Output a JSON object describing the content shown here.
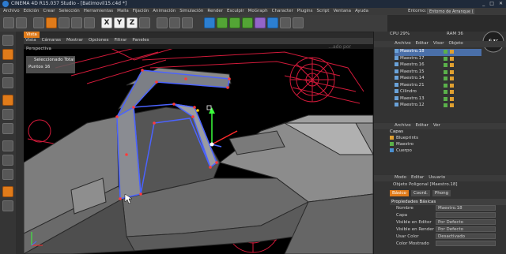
{
  "window": {
    "title": "CINEMA 4D R15.037 Studio - [Batimovil15.c4d *]",
    "controls": [
      "_",
      "□",
      "✕"
    ]
  },
  "menubar": {
    "items": [
      "Archivo",
      "Edición",
      "Crear",
      "Selección",
      "Herramientas",
      "Malla",
      "Fijación",
      "Animación",
      "Simulación",
      "Render",
      "Esculpir",
      "MoGraph",
      "Character",
      "Plugins",
      "Script",
      "Ventana",
      "Ayuda"
    ],
    "entorno_label": "Entorno:",
    "entorno_value": "Entorno de Arranque (Usuario)"
  },
  "toolbar": {
    "xyz": [
      "X",
      "Y",
      "Z"
    ]
  },
  "viewport": {
    "tab": "Vista",
    "menu": [
      "Vista",
      "Cámaras",
      "Mostrar",
      "Opciones",
      "Filtrar",
      "Paneles"
    ],
    "label": "Perspectiva",
    "selection_title": "Seleccionado Total",
    "points_label": "Puntos",
    "points_value": "16",
    "watermark": "...ado por"
  },
  "rightpanel": {
    "cpu": "CPU 29%",
    "ram": "RAM 36",
    "objects_menu": [
      "Archivo",
      "Editar",
      "Visor",
      "Objeto"
    ],
    "objects": [
      {
        "name": "Maestro.18",
        "selected": true
      },
      {
        "name": "Maestro.17",
        "selected": false
      },
      {
        "name": "Maestro.16",
        "selected": false
      },
      {
        "name": "Maestro.15",
        "selected": false
      },
      {
        "name": "Maestro.14",
        "selected": false
      },
      {
        "name": "Maestro.21",
        "selected": false
      },
      {
        "name": "Cilindro",
        "selected": false
      },
      {
        "name": "Maestro.13",
        "selected": false
      },
      {
        "name": "Maestro.12",
        "selected": false
      }
    ],
    "layers_menu": [
      "Archivo",
      "Editar",
      "Ver"
    ],
    "layers_title": "Capas",
    "layers": [
      {
        "name": "Blueprints",
        "color": "#e0a030"
      },
      {
        "name": "Maestro",
        "color": "#5ab04a"
      },
      {
        "name": "Cuerpo",
        "color": "#4a8fd0"
      }
    ],
    "attr_menu": [
      "Modo",
      "Editar",
      "Usuario"
    ],
    "attr_title": "Objeto Poligonal [Maestro.18]",
    "attr_tabs": [
      "Básico",
      "Coord.",
      "Phong"
    ],
    "attr_section": "Propiedades Básicas",
    "attr_rows": [
      {
        "label": "Nombre",
        "value": "Maestro.18"
      },
      {
        "label": "Capa",
        "value": ""
      },
      {
        "label": "Visible en Editor",
        "value": "Por Defecto"
      },
      {
        "label": "Visible en Render",
        "value": "Por Defecto"
      },
      {
        "label": "Usar Color",
        "value": "Desactivado"
      },
      {
        "label": "Color Mostrado",
        "value": ""
      }
    ]
  }
}
